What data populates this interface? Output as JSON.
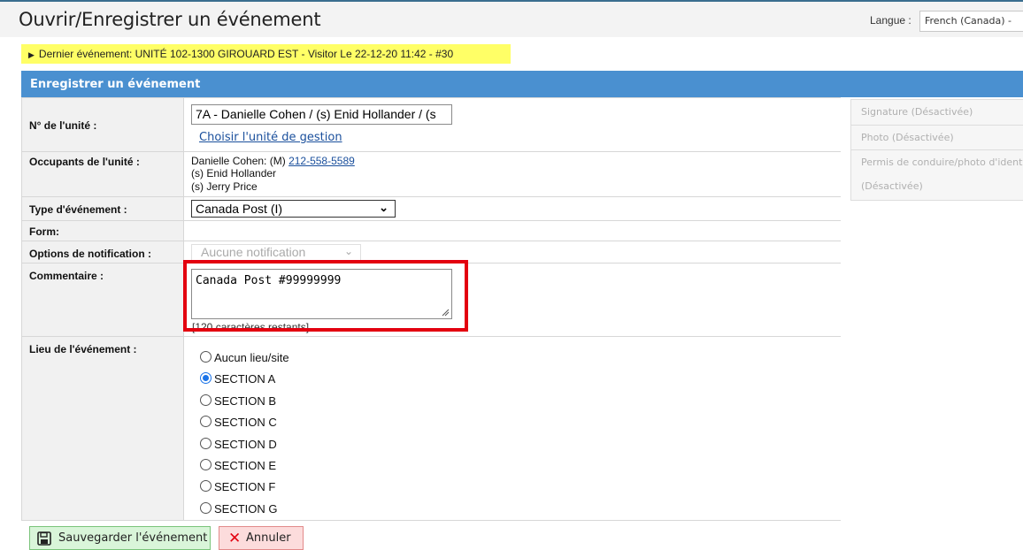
{
  "header": {
    "title": "Ouvrir/Enregistrer un événement",
    "language_label": "Langue :",
    "language_value": "French (Canada) -"
  },
  "last_event": {
    "text": "Dernier événement: UNITÉ 102-1300 GIROUARD EST - Visitor Le 22-12-20 11:42 - #30"
  },
  "panel": {
    "title": "Enregistrer un événement"
  },
  "form": {
    "unit_label": "N° de l'unité :",
    "unit_value": "7A - Danielle Cohen / (s) Enid Hollander / (s",
    "choose_unit_link": "Choisir l'unité de gestion",
    "occupants_label": "Occupants de l'unité :",
    "occupants": {
      "line1_prefix": "Danielle Cohen: (M)",
      "phone": "212-558-5589",
      "line2": "(s) Enid Hollander",
      "line3": "(s) Jerry Price"
    },
    "event_type_label": "Type d'événement :",
    "event_type_value": "Canada Post (I)",
    "form_label": "Form:",
    "notification_label": "Options de notification :",
    "notification_value": "Aucune notification",
    "comment_label": "Commentaire :",
    "comment_value": "Canada Post #99999999",
    "chars_remaining": "[120 caractères restants]",
    "location_label": "Lieu de l'événement :",
    "locations": [
      {
        "label": "Aucun lieu/site",
        "checked": false
      },
      {
        "label": "SECTION A",
        "checked": true
      },
      {
        "label": "SECTION B",
        "checked": false
      },
      {
        "label": "SECTION C",
        "checked": false
      },
      {
        "label": "SECTION D",
        "checked": false
      },
      {
        "label": "SECTION E",
        "checked": false
      },
      {
        "label": "SECTION F",
        "checked": false
      },
      {
        "label": "SECTION G",
        "checked": false
      }
    ]
  },
  "side_panel": {
    "signature": "Signature (Désactivée)",
    "photo": "Photo (Désactivée)",
    "license_line1": "Permis de conduire/photo d'identité",
    "license_line2": "(Désactivée)"
  },
  "actions": {
    "save_label": "Sauvegarder l'événement",
    "cancel_label": "Annuler"
  },
  "colors": {
    "panel_header": "#4a90d0",
    "last_event_bg": "#ffff66",
    "highlight": "#e3000f",
    "save_bg": "#d9f5d9",
    "cancel_bg": "#fcdcdc"
  }
}
